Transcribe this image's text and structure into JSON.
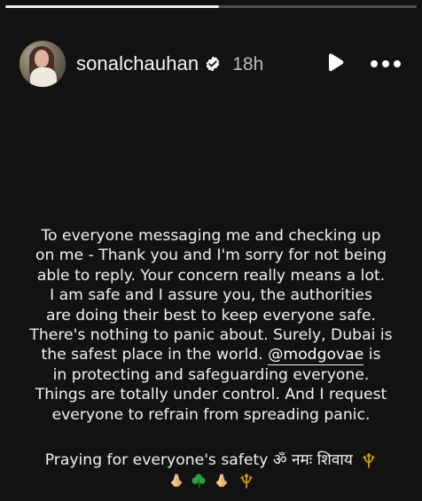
{
  "progress": {
    "value_percent": 52
  },
  "header": {
    "username": "sonalchauhan",
    "timestamp": "18h",
    "verified_icon": "verified-badge-icon",
    "play_icon": "play-icon",
    "more_icon": "more-options-icon"
  },
  "caption": {
    "lines": [
      "To everyone messaging me and checking up",
      "on me - Thank you and I'm sorry for not being",
      "able to reply. Your concern really means a lot.",
      "I am safe and I assure you, the authorities",
      "are doing their best to keep everyone safe.",
      "There's nothing to panic about. Surely, Dubai is",
      "the safest place in the world.",
      "@modgovae",
      "is",
      "in protecting and safeguarding everyone.",
      "Things are totally under control. And I request",
      "everyone  to refrain from spreading panic."
    ]
  },
  "footer": {
    "prayer_text": "Praying for everyone's safety ॐ नमः शिवाय",
    "emoji_icons": [
      "folded-hands-icon",
      "shamrock-icon",
      "folded-hands-icon",
      "trident-icon"
    ]
  },
  "colors": {
    "background": "#121212",
    "text": "#f1f1f1",
    "muted_text": "#bdbdbd",
    "trident": "#d6a000",
    "shamrock": "#2f9e44",
    "pray": "#f2c38b"
  }
}
